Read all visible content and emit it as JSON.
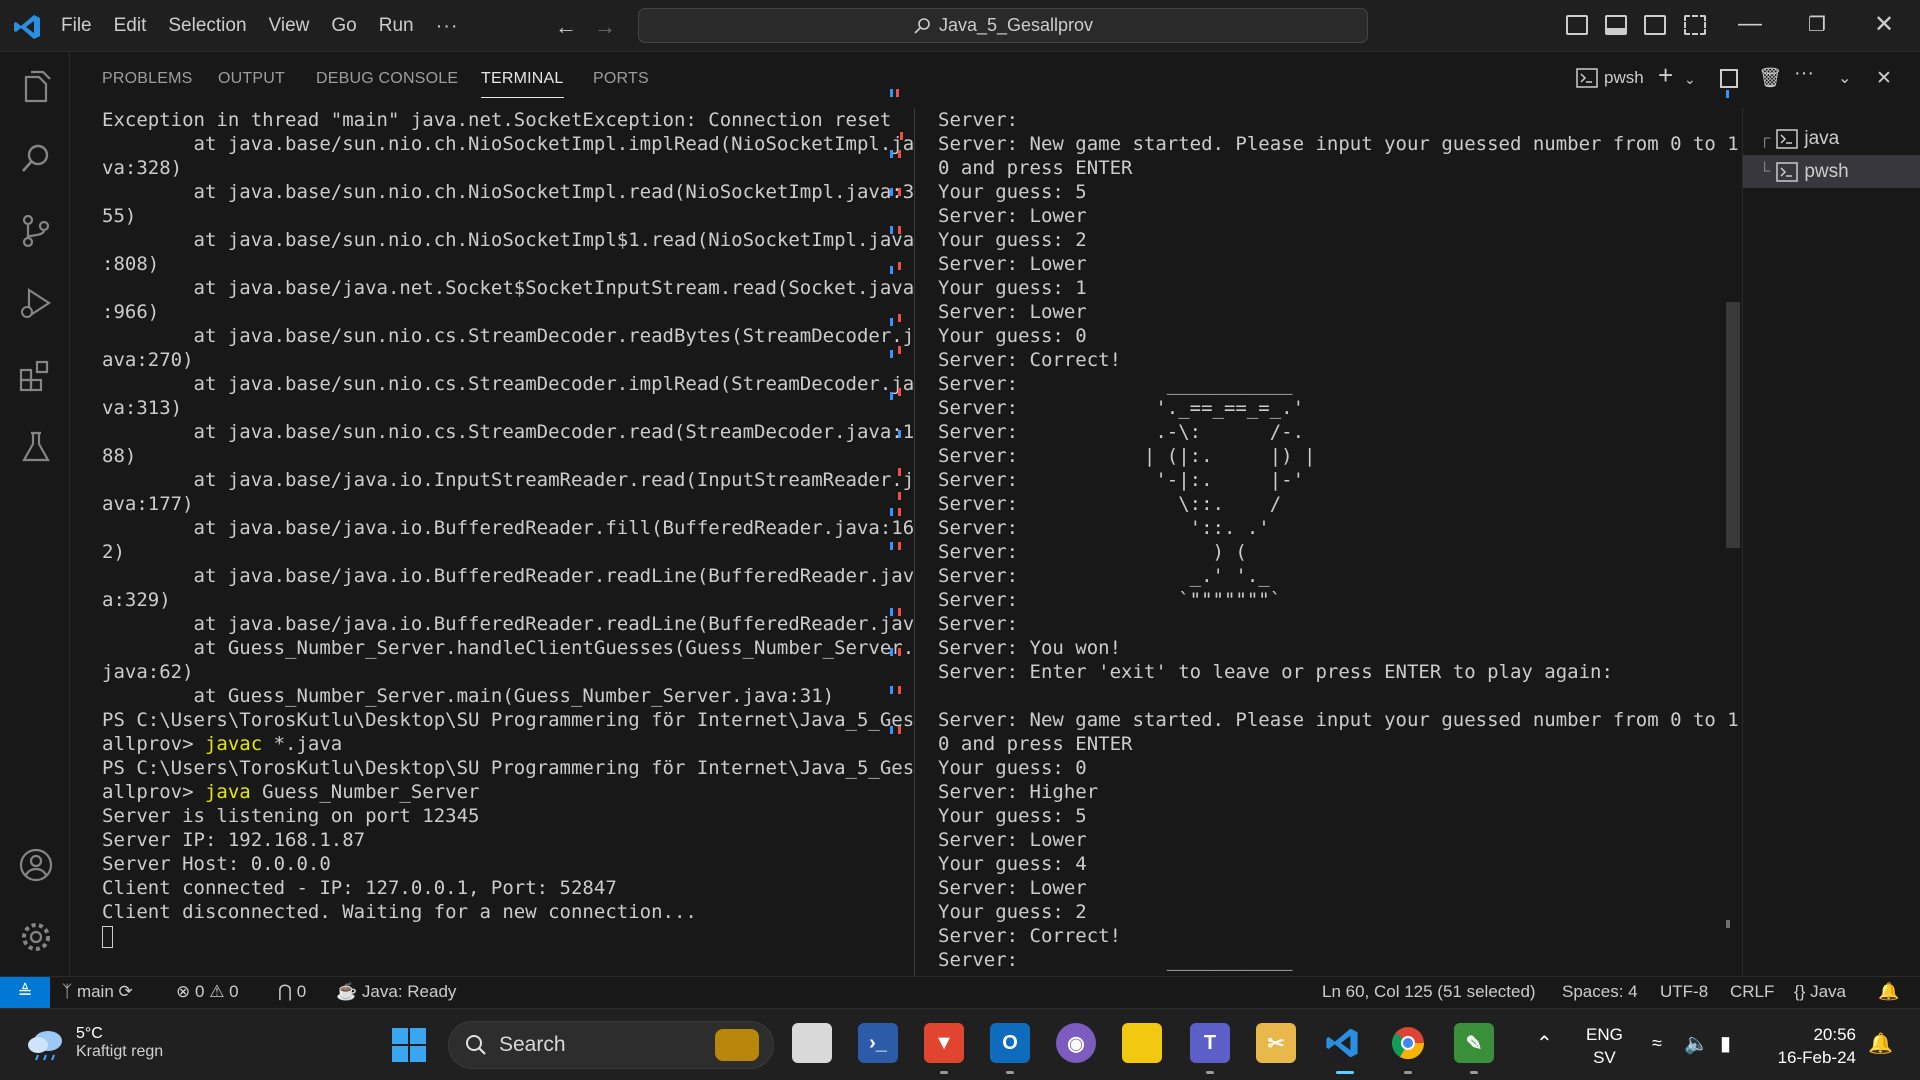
{
  "titlebar": {
    "menu": [
      "File",
      "Edit",
      "Selection",
      "View",
      "Go",
      "Run",
      "···"
    ],
    "search_text": "Java_5_Gesallprov"
  },
  "panel": {
    "tabs": [
      "PROBLEMS",
      "OUTPUT",
      "DEBUG CONSOLE",
      "TERMINAL",
      "PORTS"
    ],
    "active_tab": "TERMINAL",
    "shell_label": "pwsh",
    "terminals": [
      "java",
      "pwsh"
    ]
  },
  "terminal_left": {
    "lines": [
      "Exception in thread \"main\" java.net.SocketException: Connection reset",
      "        at java.base/sun.nio.ch.NioSocketImpl.implRead(NioSocketImpl.ja",
      "va:328)",
      "        at java.base/sun.nio.ch.NioSocketImpl.read(NioSocketImpl.java:3",
      "55)",
      "        at java.base/sun.nio.ch.NioSocketImpl$1.read(NioSocketImpl.java",
      ":808)",
      "        at java.base/java.net.Socket$SocketInputStream.read(Socket.java",
      ":966)",
      "        at java.base/sun.nio.cs.StreamDecoder.readBytes(StreamDecoder.j",
      "ava:270)",
      "        at java.base/sun.nio.cs.StreamDecoder.implRead(StreamDecoder.ja",
      "va:313)",
      "        at java.base/sun.nio.cs.StreamDecoder.read(StreamDecoder.java:1",
      "88)",
      "        at java.base/java.io.InputStreamReader.read(InputStreamReader.j",
      "ava:177)",
      "        at java.base/java.io.BufferedReader.fill(BufferedReader.java:16",
      "2)",
      "        at java.base/java.io.BufferedReader.readLine(BufferedReader.jav",
      "a:329)",
      "        at java.base/java.io.BufferedReader.readLine(BufferedReader.jav",
      "        at Guess_Number_Server.handleClientGuesses(Guess_Number_Server.",
      "java:62)",
      "        at Guess_Number_Server.main(Guess_Number_Server.java:31)",
      "PS C:\\Users\\TorosKutlu\\Desktop\\SU Programmering för Internet\\Java_5_Ges"
    ],
    "prompt_cont": "allprov> ",
    "cmd1_exe": "javac",
    "cmd1_args": " *.java",
    "prompt2": "PS C:\\Users\\TorosKutlu\\Desktop\\SU Programmering för Internet\\Java_5_Ges",
    "cmd2_exe": "java",
    "cmd2_args": " Guess_Number_Server",
    "tail": [
      "Server is listening on port 12345",
      "Server IP: 192.168.1.87",
      "Server Host: 0.0.0.0",
      "Client connected - IP: 127.0.0.1, Port: 52847",
      "Client disconnected. Waiting for a new connection..."
    ]
  },
  "terminal_right": {
    "lines": [
      "Server:",
      "Server: New game started. Please input your guessed number from 0 to 1",
      "0 and press ENTER",
      "Your guess: 5",
      "Server: Lower",
      "Your guess: 2",
      "Server: Lower",
      "Your guess: 1",
      "Server: Lower",
      "Your guess: 0",
      "Server: Correct!",
      "Server:             ___________",
      "Server:            '._==_==_=_.'",
      "Server:            .-\\:      /-.",
      "Server:           | (|:.     |) |",
      "Server:            '-|:.     |-'",
      "Server:              \\::.    /",
      "Server:               '::. .'",
      "Server:                 ) (",
      "Server:               _.' '._",
      "Server:              `\"\"\"\"\"\"\"`",
      "Server:",
      "Server: You won!",
      "Server: Enter 'exit' to leave or press ENTER to play again:",
      "",
      "Server: New game started. Please input your guessed number from 0 to 1",
      "0 and press ENTER",
      "Your guess: 0",
      "Server: Higher",
      "Your guess: 5",
      "Server: Lower",
      "Your guess: 4",
      "Server: Lower",
      "Your guess: 2",
      "Server: Correct!",
      "Server:             ___________"
    ]
  },
  "statusbar": {
    "branch": "main",
    "errors": "0",
    "warnings": "0",
    "ports": "0",
    "java_status": "Java: Ready",
    "position": "Ln 60, Col 125 (51 selected)",
    "spaces": "Spaces: 4",
    "encoding": "UTF-8",
    "eol": "CRLF",
    "language": "Java"
  },
  "taskbar": {
    "weather_temp": "5°C",
    "weather_desc": "Kraftigt regn",
    "search_label": "Search",
    "lang1": "ENG",
    "lang2": "SV",
    "time": "20:56",
    "date": "16-Feb-24"
  },
  "colors": {
    "accent": "#0078d4",
    "terminal_yellow": "#e5e510",
    "error_mark": "#f14c4c",
    "info_mark": "#3794ff"
  }
}
